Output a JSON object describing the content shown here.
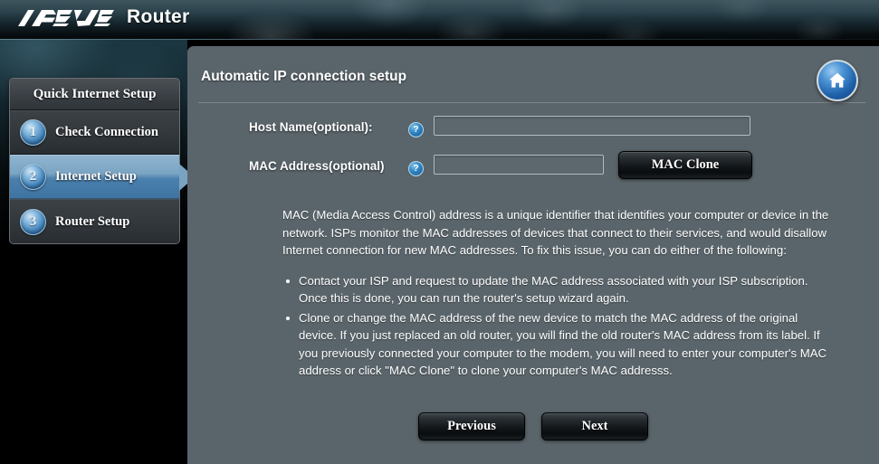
{
  "header": {
    "brand": "ASUS",
    "product": "Router"
  },
  "sidebar": {
    "title": "Quick Internet Setup",
    "items": [
      {
        "number": "1",
        "label": "Check Connection",
        "active": false
      },
      {
        "number": "2",
        "label": "Internet Setup",
        "active": true
      },
      {
        "number": "3",
        "label": "Router Setup",
        "active": false
      }
    ]
  },
  "main": {
    "title": "Automatic IP connection setup",
    "home_icon": "home-icon",
    "form": {
      "host_name": {
        "label": "Host Name(optional):",
        "value": "",
        "placeholder": "",
        "help_icon": "question-mark-icon"
      },
      "mac_address": {
        "label": "MAC Address(optional)",
        "value": "",
        "placeholder": "",
        "help_icon": "question-mark-icon"
      },
      "mac_clone_button": "MAC Clone"
    },
    "description": {
      "intro": "MAC (Media Access Control) address is a unique identifier that identifies your computer or device in the network. ISPs monitor the MAC addresses of devices that connect to their services, and would disallow Internet connection for new MAC addresses. To fix this issue, you can do either of the following:",
      "bullets": [
        "Contact your ISP and request to update the MAC address associated with your ISP subscription. Once this is done, you can run the router's setup wizard again.",
        "Clone or change the MAC address of the new device to match the MAC address of the original device. If you just replaced an old router, you will find the old router's MAC address from its label. If you previously connected your computer to the modem, you will need to enter your computer's MAC address or click \"MAC Clone\" to clone your computer's MAC addresss."
      ]
    },
    "footer": {
      "previous_label": "Previous",
      "next_label": "Next"
    }
  },
  "colors": {
    "panel_background": "#5a656b",
    "accent_blue": "#4a80ad",
    "active_menu_blue": "#7ba5c4",
    "button_dark": "#13171a",
    "text_white": "#ffffff"
  }
}
